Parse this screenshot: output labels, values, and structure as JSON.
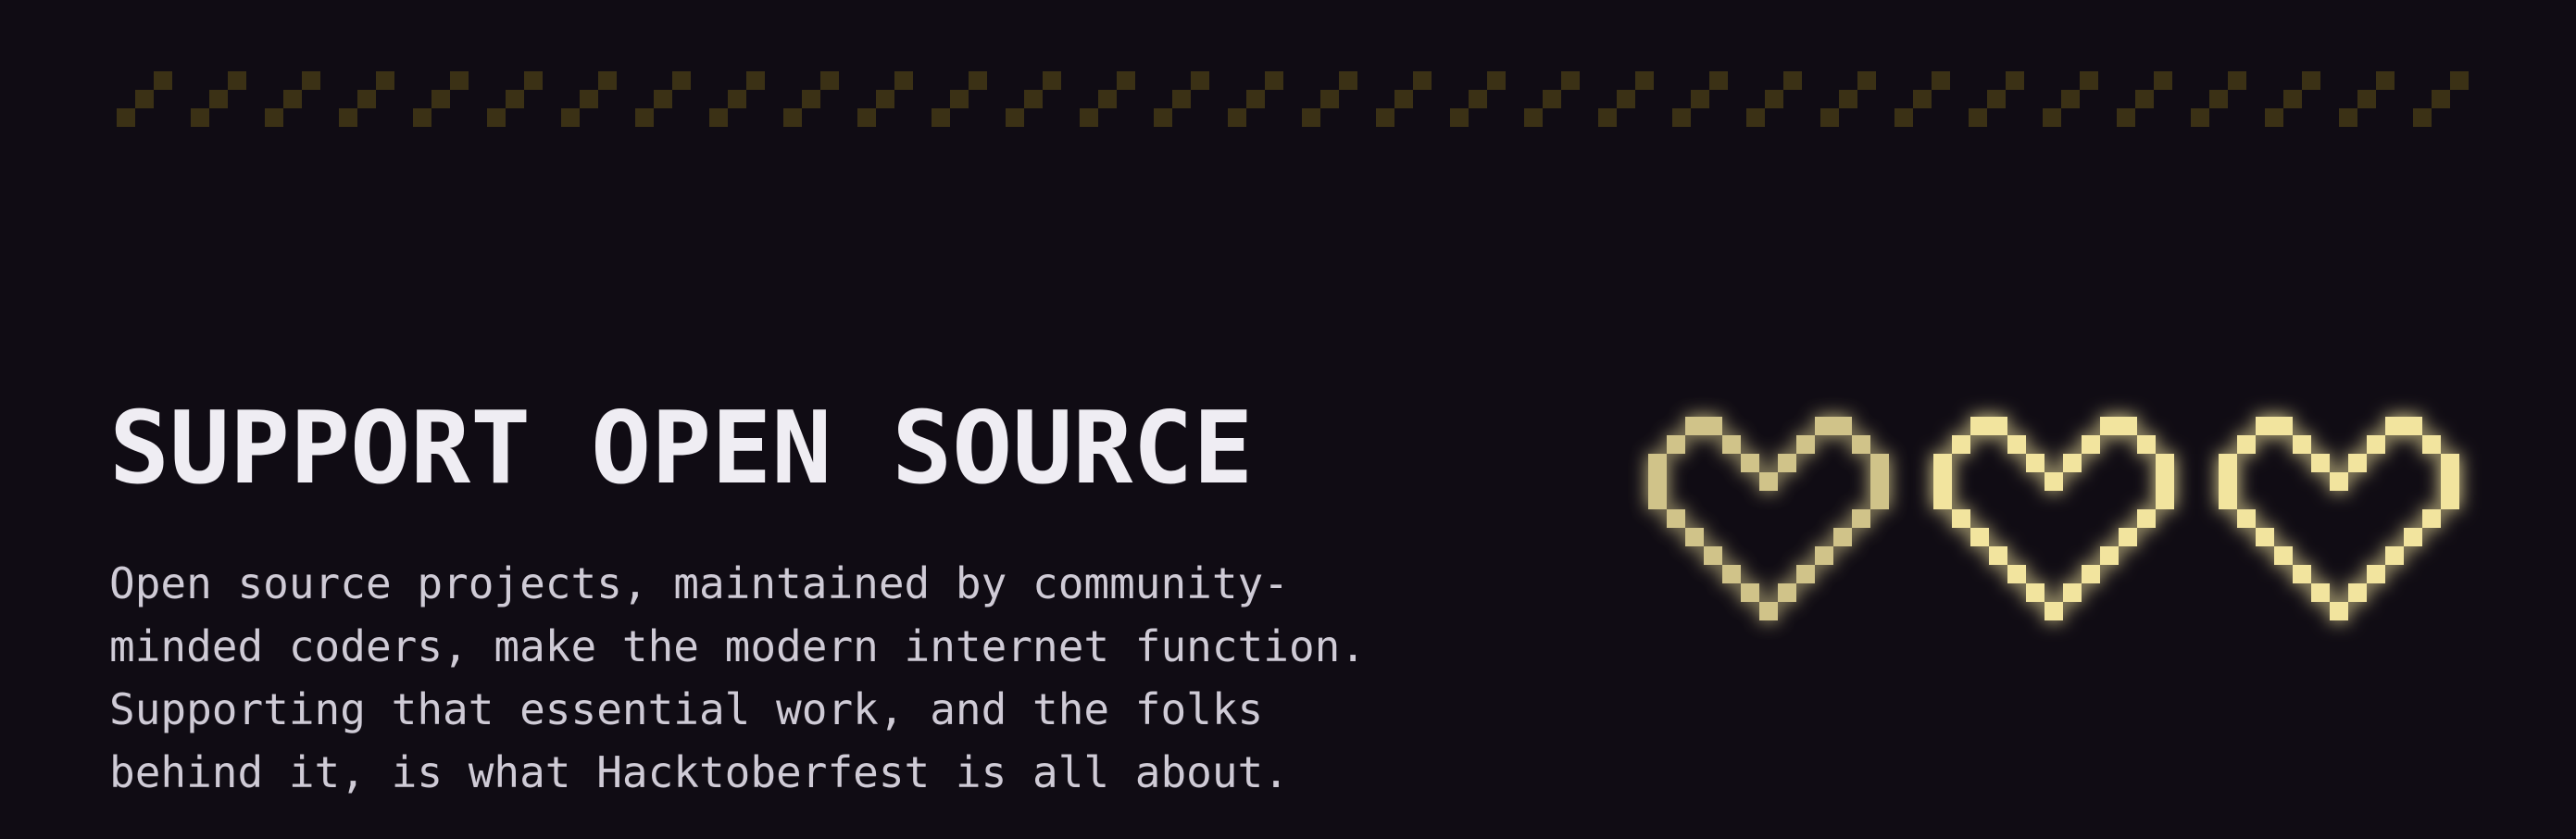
{
  "section": {
    "title": "SUPPORT OPEN SOURCE",
    "body_lines": [
      "Open source projects, maintained by community-",
      "minded coders, make the modern internet function.",
      "Supporting that essential work, and the folks",
      "behind it, is what Hacktoberfest is all about."
    ]
  },
  "decor": {
    "border_pattern": "diagonal-pixel-stairs",
    "heart_icon": "pixel-heart-outline",
    "heart_count": 3
  },
  "colors": {
    "background": "#100c14",
    "title": "#efedf3",
    "body_text": "#cfcbd6",
    "border_pixels": "#3b3115",
    "heart": "#f2e49e",
    "heart_glow": "#f5e9a6"
  }
}
